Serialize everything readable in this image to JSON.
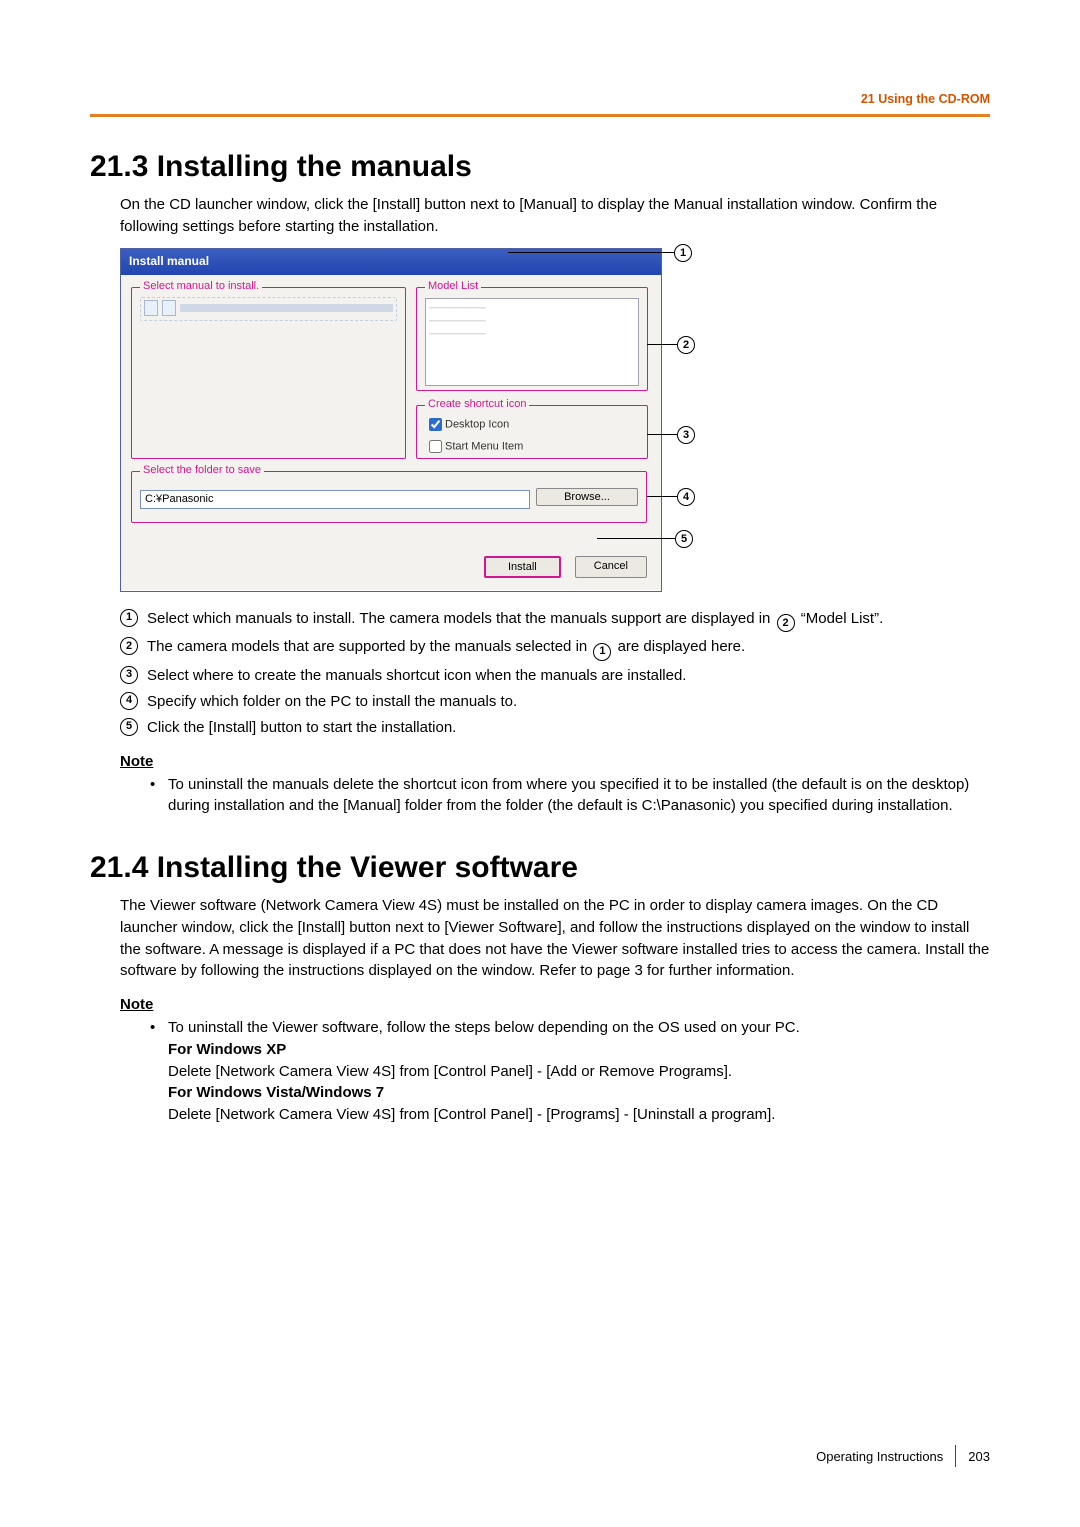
{
  "header": {
    "running_head": "21 Using the CD-ROM"
  },
  "sec213": {
    "title": "21.3  Installing the manuals",
    "intro": "On the CD launcher window, click the [Install] button next to [Manual] to display the Manual installation window. Confirm the following settings before starting the installation."
  },
  "dialog": {
    "title": "Install manual",
    "group_select_label": "Select manual to install.",
    "group_model_label": "Model List",
    "group_shortcut_label": "Create shortcut icon",
    "chk_desktop": "Desktop Icon",
    "chk_startmenu": "Start Menu Item",
    "group_folder_label": "Select the folder to save",
    "folder_value": "C:¥Panasonic",
    "browse": "Browse...",
    "install": "Install",
    "cancel": "Cancel"
  },
  "callouts": {
    "n1": "1",
    "n2": "2",
    "n3": "3",
    "n4": "4",
    "n5": "5"
  },
  "legend": {
    "i1a": "Select which manuals to install. The camera models that the manuals support are displayed in ",
    "i1b": " “Model List”.",
    "i2a": "The camera models that are supported by the manuals selected in ",
    "i2b": " are displayed here.",
    "i3": "Select where to create the manuals shortcut icon when the manuals are installed.",
    "i4": "Specify which folder on the PC to install the manuals to.",
    "i5": "Click the [Install] button to start the installation."
  },
  "note1": {
    "title": "Note",
    "text": "To uninstall the manuals delete the shortcut icon from where you specified it to be installed (the default is on the desktop) during installation and the [Manual] folder from the folder (the default is C:\\Panasonic) you specified during installation."
  },
  "sec214": {
    "title": "21.4  Installing the Viewer software",
    "intro": "The Viewer software (Network Camera View 4S) must be installed on the PC in order to display camera images. On the CD launcher window, click the [Install] button next to [Viewer Software], and follow the instructions displayed on the window to install the software. A message is displayed if a PC that does not have the Viewer software installed tries to access the camera. Install the software by following the instructions displayed on the window. Refer to page 3 for further information."
  },
  "note2": {
    "title": "Note",
    "lead": "To uninstall the Viewer software, follow the steps below depending on the OS used on your PC.",
    "xp_h": "For Windows XP",
    "xp_t": "Delete [Network Camera View 4S] from [Control Panel] - [Add or Remove Programs].",
    "v7_h": "For Windows Vista/Windows 7",
    "v7_t": "Delete [Network Camera View 4S] from [Control Panel] - [Programs] - [Uninstall a program]."
  },
  "footer": {
    "text": "Operating Instructions",
    "page": "203"
  }
}
